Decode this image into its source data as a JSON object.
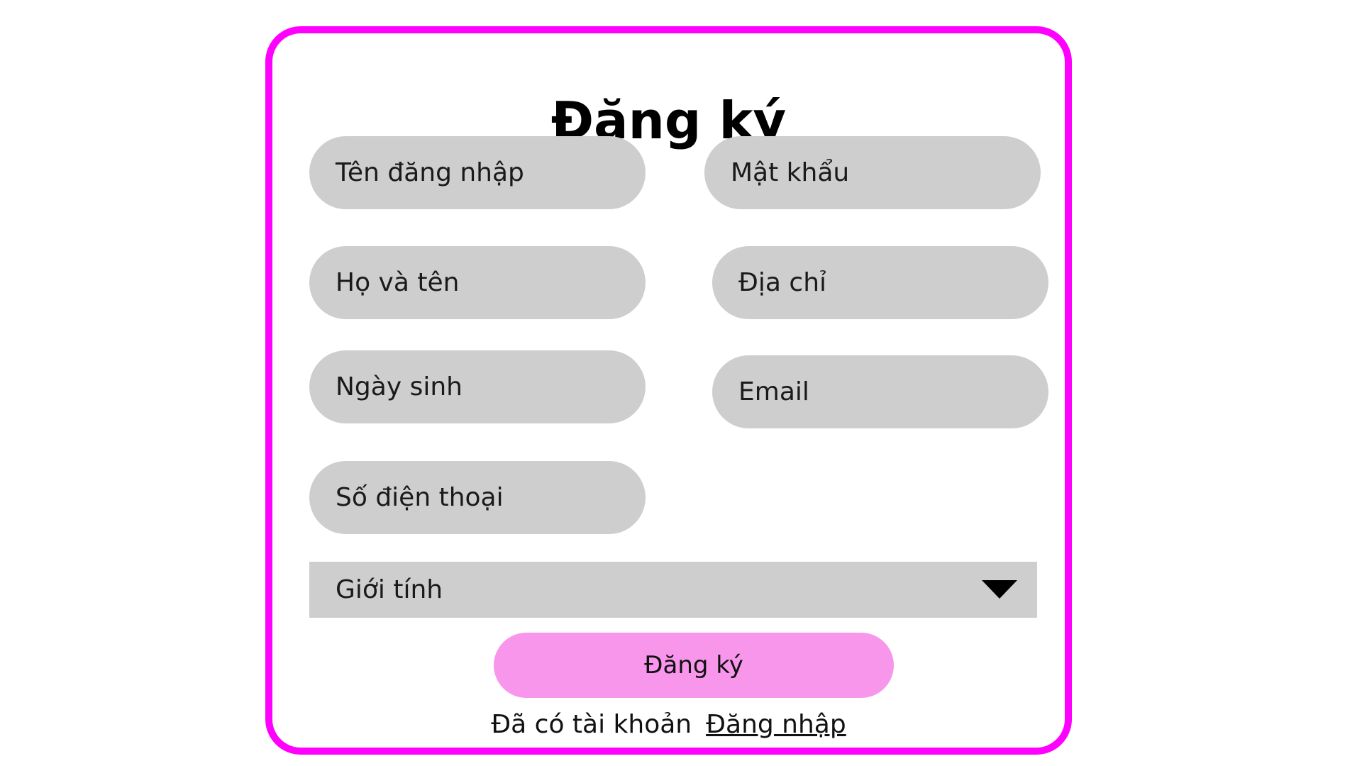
{
  "form": {
    "title": "Đăng ký",
    "fields": {
      "username": "Tên đăng nhập",
      "password": "Mật khẩu",
      "fullname": "Họ và tên",
      "address": "Địa chỉ",
      "birthday": "Ngày sinh",
      "email": "Email",
      "phone": "Số điện thoại"
    },
    "gender_select": "Giới tính",
    "submit_label": "Đăng ký",
    "footer": {
      "prompt": "Đã có tài khoản",
      "login_link": "Đăng nhập"
    }
  },
  "colors": {
    "card_border": "#ff00ff",
    "field_bg": "#cecece",
    "submit_bg": "#f896ec"
  }
}
